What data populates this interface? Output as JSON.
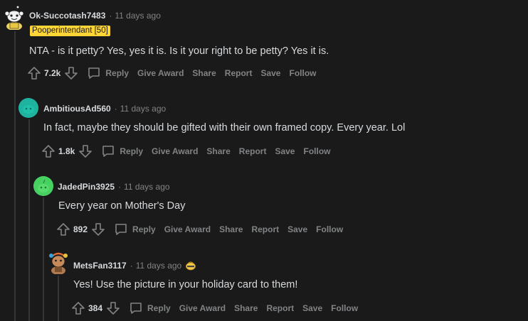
{
  "colors": {
    "background": "#1a1a1b",
    "text": "#d7dadc",
    "muted": "#818384",
    "flair_bg": "#ffd635",
    "thread_line": "#343536"
  },
  "comments": [
    {
      "username": "Ok-Succotash7483",
      "time": "11 days ago",
      "flair": "Pooperintendant [50]",
      "text": "NTA - is it petty? Yes, yes it is. Is it your right to be petty? Yes it is.",
      "votes": "7.2k",
      "avatar_icon": "snoo-avatar-yellow-outfit"
    },
    {
      "username": "AmbitiousAd560",
      "time": "11 days ago",
      "text": "In fact, maybe they should be gifted with their own framed copy. Every year. Lol",
      "votes": "1.8k",
      "avatar_icon": "teal-snoo-avatar"
    },
    {
      "username": "JadedPin3925",
      "time": "11 days ago",
      "text": "Every year on Mother's Day",
      "votes": "892",
      "avatar_icon": "green-snoo-avatar"
    },
    {
      "username": "MetsFan3117",
      "time": "11 days ago",
      "text": "Yes! Use the picture in your holiday card to them!",
      "votes": "384",
      "avatar_icon": "snoo-avatar-with-headphones",
      "award_icon": "rocket-like-award-icon"
    }
  ],
  "actions": {
    "reply": "Reply",
    "give_award": "Give Award",
    "share": "Share",
    "report": "Report",
    "save": "Save",
    "follow": "Follow"
  }
}
